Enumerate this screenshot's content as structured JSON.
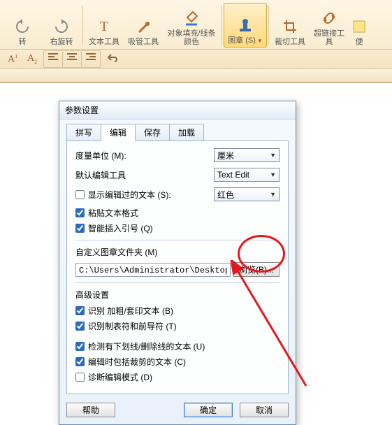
{
  "ribbon": {
    "undo": "转",
    "redo": "右旋转",
    "text_tool": "文本工具",
    "eyedrop": "吸管工具",
    "fill_stroke": "对象填充/线条颜色",
    "stamp": "图章 (S)",
    "crop": "裁切工具",
    "hyperlink": "超链接工具",
    "sticky": "便"
  },
  "subbar": {
    "sup1": "A",
    "sup2": "A₁",
    "sub": "A₂"
  },
  "dialog": {
    "title": "参数设置",
    "tabs": {
      "spell": "拼写",
      "edit": "编辑",
      "save": "保存",
      "load": "加载"
    },
    "unit_label": "度量单位 (M):",
    "unit_value": "厘米",
    "default_tool_label": "默认编辑工具",
    "default_tool_value": "Text Edit",
    "show_edited_label": "显示编辑过的文本 (S):",
    "show_edited_color": "红色",
    "paste_format": "粘贴文本格式",
    "smart_quotes": "智能插入引号 (Q)",
    "folder_label": "自定义图章文件夹 (M)",
    "folder_path": "C:\\Users\\Administrator\\Desktop\\引",
    "browse": "浏览(B)...",
    "advanced_label": "高级设置",
    "detect_bold": "识别 加粗/套印文本 (B)",
    "detect_tabs": "识别制表符和前导符 (T)",
    "detect_strike": "检测有下划线/删除线的文本 (U)",
    "include_clip": "编辑时包括裁剪的文本 (C)",
    "debug_mode": "诊断编辑模式 (D)",
    "help": "帮助",
    "ok": "确定",
    "cancel": "取消"
  }
}
